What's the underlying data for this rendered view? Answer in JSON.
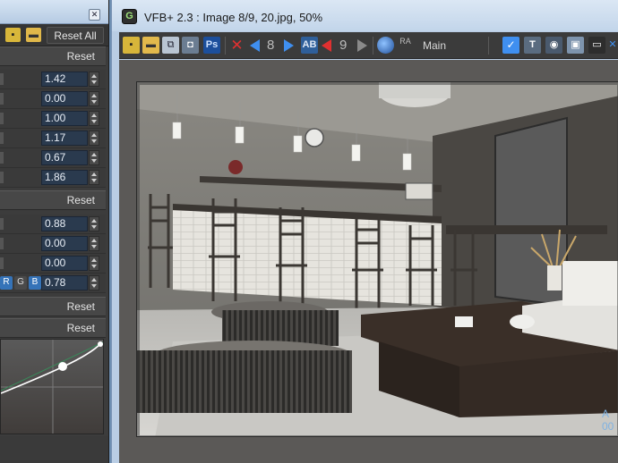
{
  "left_panel": {
    "reset_all_label": "Reset All",
    "sections": [
      {
        "reset_label": "Reset"
      },
      {
        "reset_label": "Reset"
      },
      {
        "reset_label": "Reset"
      },
      {
        "reset_label": "Reset"
      }
    ],
    "group1_values": [
      "1.42",
      "0.00",
      "1.00",
      "1.17",
      "0.67",
      "1.86"
    ],
    "group2_values": [
      "0.88",
      "0.00",
      "0.00"
    ],
    "channel_buttons": [
      "R",
      "G",
      "B"
    ],
    "channel_value": "0.78",
    "colors": {
      "panel_bg": "#3c3c3c",
      "field_bg": "#2a3a4e",
      "channel_active": "#3573b8"
    }
  },
  "vfb": {
    "title": "VFB+ 2.3 : Image 8/9, 20.jpg, 50%",
    "logo_glyph": "G",
    "toolbar": {
      "image_a_number": "8",
      "image_b_number": "9",
      "layer_label": "Main",
      "ps_label": "Ps",
      "ab_label": "AB",
      "ra_label": "RA"
    },
    "corner_overlay": [
      "A",
      "00"
    ],
    "colors": {
      "accent_blue": "#3f8ff0",
      "accent_red": "#e03030",
      "titlebar": "#c2d5ea"
    }
  }
}
